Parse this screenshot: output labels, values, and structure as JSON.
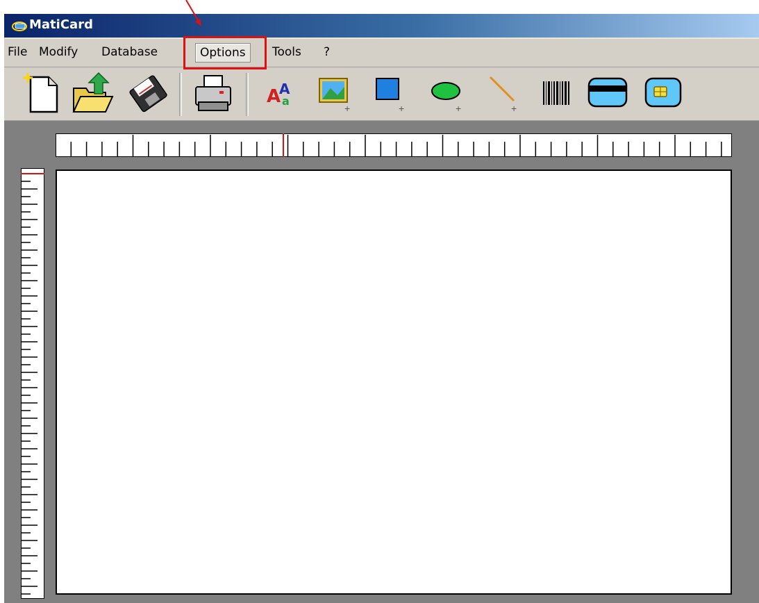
{
  "window": {
    "title": "MatiCard"
  },
  "menu": {
    "items": [
      {
        "id": "file",
        "label": "File"
      },
      {
        "id": "modify",
        "label": "Modify"
      },
      {
        "id": "database",
        "label": "Database"
      },
      {
        "id": "options",
        "label": "Options"
      },
      {
        "id": "tools",
        "label": "Tools"
      },
      {
        "id": "help",
        "label": "?"
      }
    ]
  },
  "toolbar": {
    "buttons": [
      {
        "id": "new",
        "icon": "new-document-icon"
      },
      {
        "id": "open",
        "icon": "open-folder-icon"
      },
      {
        "id": "save",
        "icon": "floppy-disk-icon"
      },
      {
        "id": "print",
        "icon": "printer-icon"
      },
      {
        "id": "text",
        "icon": "add-text-icon"
      },
      {
        "id": "image",
        "icon": "add-image-icon"
      },
      {
        "id": "rectangle",
        "icon": "add-rectangle-icon"
      },
      {
        "id": "ellipse",
        "icon": "add-ellipse-icon"
      },
      {
        "id": "line",
        "icon": "add-line-icon"
      },
      {
        "id": "barcode",
        "icon": "barcode-icon"
      },
      {
        "id": "magstripe",
        "icon": "magnetic-stripe-card-icon"
      },
      {
        "id": "chip",
        "icon": "smart-chip-card-icon"
      }
    ]
  },
  "annotation": {
    "highlighted_menu": "Options",
    "color": "#e01010"
  },
  "colors": {
    "titlebar_start": "#0a246a",
    "titlebar_end": "#a6caf0",
    "workspace": "#808080",
    "ruler_marker": "#e01010"
  }
}
